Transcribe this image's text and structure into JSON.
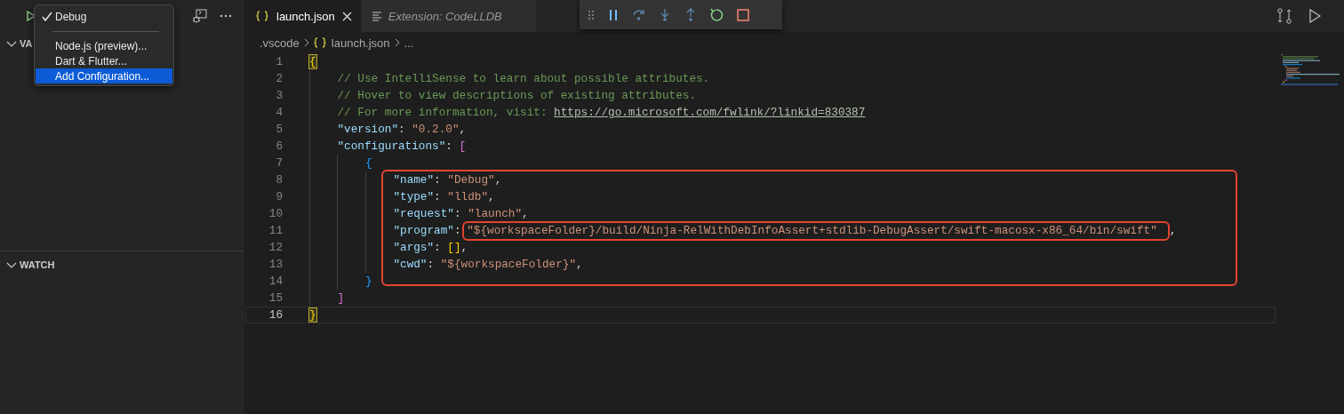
{
  "sidebar": {
    "sections": [
      {
        "title": "VA",
        "expanded": true
      },
      {
        "title": "WATCH",
        "expanded": true
      }
    ]
  },
  "config_menu": {
    "items": [
      {
        "kind": "item",
        "label": "Debug",
        "checked": true,
        "selected": false
      },
      {
        "kind": "separator"
      },
      {
        "kind": "item",
        "label": "Node.js (preview)...",
        "checked": false,
        "selected": false
      },
      {
        "kind": "item",
        "label": "Dart & Flutter...",
        "checked": false,
        "selected": false
      },
      {
        "kind": "item",
        "label": "Add Configuration...",
        "checked": false,
        "selected": true
      }
    ]
  },
  "tabs": [
    {
      "label": "launch.json",
      "selected": true,
      "kind": "json"
    },
    {
      "label": "Extension: CodeLLDB",
      "selected": false,
      "kind": "preview"
    }
  ],
  "breadcrumb": [
    {
      "label": ".vscode",
      "kind": "folder"
    },
    {
      "label": "launch.json",
      "kind": "json"
    },
    {
      "label": "...",
      "kind": "more"
    }
  ],
  "editor": {
    "lines": [
      {
        "number": "1",
        "current": false,
        "tokens": [
          {
            "kind": "bracket1",
            "text": "{",
            "matched": true
          }
        ]
      },
      {
        "number": "2",
        "current": false,
        "tokens": [
          {
            "kind": "comment",
            "text": "// Use IntelliSense to learn about possible attributes."
          }
        ]
      },
      {
        "number": "3",
        "current": false,
        "tokens": [
          {
            "kind": "comment",
            "text": "// Hover to view descriptions of existing attributes."
          }
        ]
      },
      {
        "number": "4",
        "current": false,
        "tokens": [
          {
            "kind": "comment",
            "text": "// For more information, visit: "
          },
          {
            "kind": "link",
            "text": "https://go.microsoft.com/fwlink/?linkid=830387"
          }
        ]
      },
      {
        "number": "5",
        "current": false,
        "tokens": [
          {
            "kind": "key",
            "text": "\"version\""
          },
          {
            "kind": "punct",
            "text": ": "
          },
          {
            "kind": "string",
            "text": "\"0.2.0\""
          },
          {
            "kind": "punct",
            "text": ","
          }
        ]
      },
      {
        "number": "6",
        "current": false,
        "tokens": [
          {
            "kind": "key",
            "text": "\"configurations\""
          },
          {
            "kind": "punct",
            "text": ": "
          },
          {
            "kind": "bracket2",
            "text": "["
          }
        ]
      },
      {
        "number": "7",
        "current": false,
        "tokens": [
          {
            "kind": "bracket3",
            "text": "{"
          }
        ]
      },
      {
        "number": "8",
        "current": false,
        "tokens": [
          {
            "kind": "key",
            "text": "\"name\""
          },
          {
            "kind": "punct",
            "text": ": "
          },
          {
            "kind": "string",
            "text": "\"Debug\""
          },
          {
            "kind": "punct",
            "text": ","
          }
        ]
      },
      {
        "number": "9",
        "current": false,
        "tokens": [
          {
            "kind": "key",
            "text": "\"type\""
          },
          {
            "kind": "punct",
            "text": ": "
          },
          {
            "kind": "string",
            "text": "\"lldb\""
          },
          {
            "kind": "punct",
            "text": ","
          }
        ]
      },
      {
        "number": "10",
        "current": false,
        "tokens": [
          {
            "kind": "key",
            "text": "\"request\""
          },
          {
            "kind": "punct",
            "text": ": "
          },
          {
            "kind": "string",
            "text": "\"launch\""
          },
          {
            "kind": "punct",
            "text": ","
          }
        ]
      },
      {
        "number": "11",
        "current": false,
        "tokens": [
          {
            "kind": "key",
            "text": "\"program\""
          },
          {
            "kind": "punct",
            "text": ": "
          },
          {
            "kind": "string",
            "text": "\"${workspaceFolder}/build/Ninja-RelWithDebInfoAssert+stdlib-DebugAssert/swift-macosx-x86_64/bin/swift\"",
            "annotated": true
          },
          {
            "kind": "punct",
            "text": ","
          }
        ]
      },
      {
        "number": "12",
        "current": false,
        "tokens": [
          {
            "kind": "key",
            "text": "\"args\""
          },
          {
            "kind": "punct",
            "text": ": "
          },
          {
            "kind": "bracket1",
            "text": "[]"
          },
          {
            "kind": "punct",
            "text": ","
          }
        ]
      },
      {
        "number": "13",
        "current": false,
        "tokens": [
          {
            "kind": "key",
            "text": "\"cwd\""
          },
          {
            "kind": "punct",
            "text": ": "
          },
          {
            "kind": "string",
            "text": "\"${workspaceFolder}\""
          },
          {
            "kind": "punct",
            "text": ","
          }
        ]
      },
      {
        "number": "14",
        "current": false,
        "tokens": [
          {
            "kind": "bracket3",
            "text": "}"
          }
        ]
      },
      {
        "number": "15",
        "current": false,
        "tokens": [
          {
            "kind": "bracket2",
            "text": "]"
          }
        ]
      },
      {
        "number": "16",
        "current": true,
        "tokens": [
          {
            "kind": "bracket1",
            "text": "}",
            "matched": true
          }
        ]
      }
    ]
  }
}
